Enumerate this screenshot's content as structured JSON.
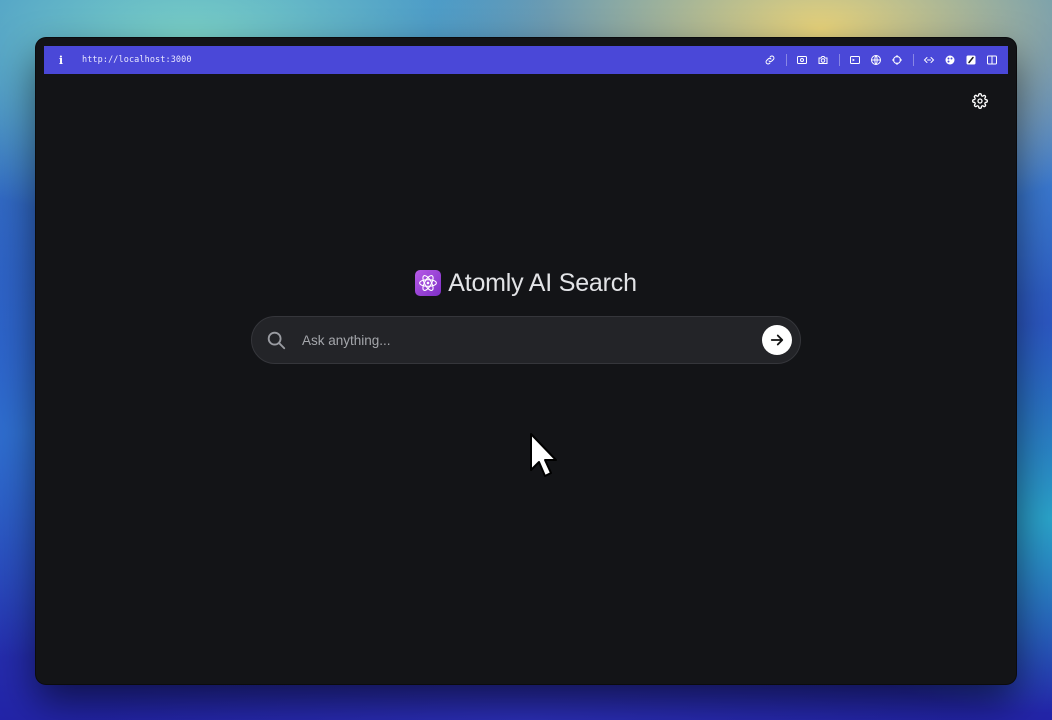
{
  "browser": {
    "url": "http://localhost:3000",
    "toolbar_icons": [
      "link-icon",
      "screenshot-icon",
      "camera-icon",
      "terminal-icon",
      "globe-icon",
      "crosshair-icon",
      "code-icon",
      "palette-icon",
      "extension-icon",
      "split-view-icon"
    ]
  },
  "app": {
    "title": "Atomly AI Search",
    "logo_icon": "atom-icon",
    "settings_icon": "gear-icon"
  },
  "search": {
    "placeholder": "Ask anything...",
    "value": "",
    "icon": "search-icon",
    "submit_icon": "arrow-right-icon"
  },
  "colors": {
    "toolbar": "#4a48d8",
    "background": "#131417",
    "search_bar": "#232428",
    "logo_gradient": "#9b45d8"
  }
}
